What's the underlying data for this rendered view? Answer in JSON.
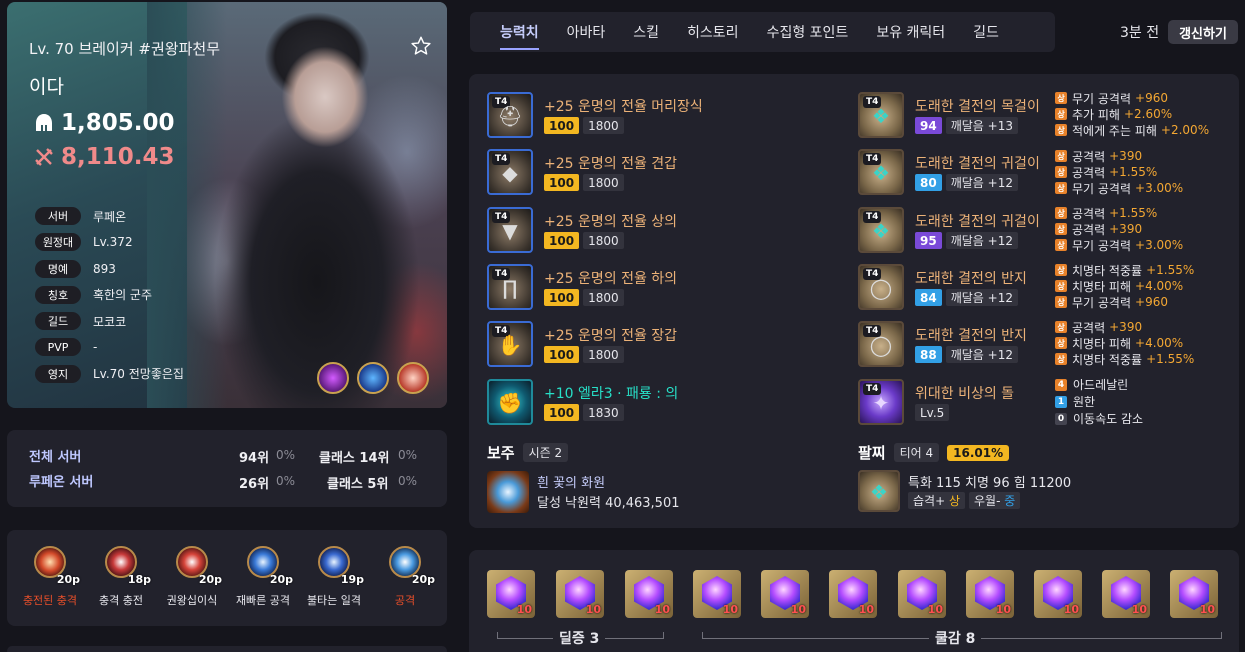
{
  "profile": {
    "level_class": "Lv. 70 브레이커 #권왕파천무",
    "name": "이다",
    "item_level": "1,805.00",
    "combat_power": "8,110.43",
    "info": [
      {
        "label": "서버",
        "value": "루페온"
      },
      {
        "label": "원정대",
        "value": "Lv.372"
      },
      {
        "label": "명예",
        "value": "893"
      },
      {
        "label": "칭호",
        "value": "혹한의 군주"
      },
      {
        "label": "길드",
        "value": "모코코"
      },
      {
        "label": "PVP",
        "value": "-"
      },
      {
        "label": "영지",
        "value": "Lv.70 전망좋은집"
      }
    ]
  },
  "ranking": {
    "total_label": "전체 서버",
    "total_rank": "94위",
    "total_pct": "0%",
    "total_class": "클래스 14위",
    "total_class_pct": "0%",
    "server_label": "루페온 서버",
    "server_rank": "26위",
    "server_pct": "0%",
    "server_class": "클래스 5위",
    "server_class_pct": "0%"
  },
  "engravings": [
    {
      "name": "충전된 충격",
      "points": "20p",
      "color": "#e94f2a",
      "icon": "spark-icon"
    },
    {
      "name": "충격 충전",
      "points": "18p",
      "color": "#e6e6ec",
      "icon": "moon-icon"
    },
    {
      "name": "권왕십이식",
      "points": "20p",
      "color": "#e6e6ec",
      "icon": "star-icon"
    },
    {
      "name": "재빠른 공격",
      "points": "20p",
      "color": "#e6e6ec",
      "icon": "sun-icon"
    },
    {
      "name": "불타는 일격",
      "points": "19p",
      "color": "#e6e6ec",
      "icon": "crescent-icon"
    },
    {
      "name": "공격",
      "points": "20p",
      "color": "#e94f2a",
      "icon": "burst-icon"
    }
  ],
  "tabs": [
    "능력치",
    "아바타",
    "스킬",
    "히스토리",
    "수집형 포인트",
    "보유 캐릭터",
    "길드"
  ],
  "updated": "3분 전",
  "refresh_label": "갱신하기",
  "armor": [
    {
      "tier": "T4",
      "name": "+25 운명의 전율 머리장식",
      "quality": "100",
      "ilvl": "1800",
      "icon": "helmet-icon"
    },
    {
      "tier": "T4",
      "name": "+25 운명의 전율 견갑",
      "quality": "100",
      "ilvl": "1800",
      "icon": "shoulder-icon"
    },
    {
      "tier": "T4",
      "name": "+25 운명의 전율 상의",
      "quality": "100",
      "ilvl": "1800",
      "icon": "chest-icon"
    },
    {
      "tier": "T4",
      "name": "+25 운명의 전율 하의",
      "quality": "100",
      "ilvl": "1800",
      "icon": "pants-icon"
    },
    {
      "tier": "T4",
      "name": "+25 운명의 전율 장갑",
      "quality": "100",
      "ilvl": "1800",
      "icon": "gloves-icon"
    }
  ],
  "weapon": {
    "name": "+10 엘라3 · 패룡 : 의",
    "quality": "100",
    "ilvl": "1830",
    "icon": "gauntlet-icon"
  },
  "accessories": [
    {
      "tier": "T4",
      "name": "도래한 결전의 목걸이",
      "quality": "94",
      "qcolor": "purple",
      "enlight": "깨달음 +13",
      "bonus": [
        {
          "k": "무기 공격력",
          "v": "+960"
        },
        {
          "k": "추가 피해",
          "v": "+2.60%"
        },
        {
          "k": "적에게 주는 피해",
          "v": "+2.00%"
        }
      ]
    },
    {
      "tier": "T4",
      "name": "도래한 결전의 귀걸이",
      "quality": "80",
      "qcolor": "blue",
      "enlight": "깨달음 +12",
      "bonus": [
        {
          "k": "공격력",
          "v": "+390"
        },
        {
          "k": "공격력",
          "v": "+1.55%"
        },
        {
          "k": "무기 공격력",
          "v": "+3.00%"
        }
      ]
    },
    {
      "tier": "T4",
      "name": "도래한 결전의 귀걸이",
      "quality": "95",
      "qcolor": "purple",
      "enlight": "깨달음 +12",
      "bonus": [
        {
          "k": "공격력",
          "v": "+1.55%"
        },
        {
          "k": "공격력",
          "v": "+390"
        },
        {
          "k": "무기 공격력",
          "v": "+3.00%"
        }
      ]
    },
    {
      "tier": "T4",
      "name": "도래한 결전의 반지",
      "quality": "84",
      "qcolor": "blue",
      "enlight": "깨달음 +12",
      "bonus": [
        {
          "k": "치명타 적중률",
          "v": "+1.55%"
        },
        {
          "k": "치명타 피해",
          "v": "+4.00%"
        },
        {
          "k": "무기 공격력",
          "v": "+960"
        }
      ]
    },
    {
      "tier": "T4",
      "name": "도래한 결전의 반지",
      "quality": "88",
      "qcolor": "blue",
      "enlight": "깨달음 +12",
      "bonus": [
        {
          "k": "공격력",
          "v": "+390"
        },
        {
          "k": "치명타 피해",
          "v": "+4.00%"
        },
        {
          "k": "치명타 적중률",
          "v": "+1.55%"
        }
      ]
    }
  ],
  "sang_label": "상",
  "stone": {
    "tier": "T4",
    "name": "위대한 비상의 돌",
    "level": "Lv.5",
    "lines": [
      {
        "n": "4",
        "color": "#e8822a",
        "text": "아드레날린"
      },
      {
        "n": "1",
        "color": "#32a0e6",
        "text": "원한"
      },
      {
        "n": "0",
        "color": "#444450",
        "text": "이동속도 감소"
      }
    ]
  },
  "jewel": {
    "title": "보주",
    "season": "시즌 2",
    "name": "흰 꽃의 화원",
    "desc": "달성 낙원력 40,463,501"
  },
  "bracelet": {
    "title": "팔찌",
    "tier": "티어 4",
    "pct": "16.01%",
    "stats": "특화 115  치명 96  힘 11200",
    "opt1_name": "습격+",
    "opt1_grade": "상",
    "opt2_name": "우월-",
    "opt2_grade": "중"
  },
  "gems": {
    "levels": [
      "10",
      "10",
      "10",
      "10",
      "10",
      "10",
      "10",
      "10",
      "10",
      "10",
      "10"
    ],
    "group1": "딜증 3",
    "group2": "쿨감 8"
  }
}
